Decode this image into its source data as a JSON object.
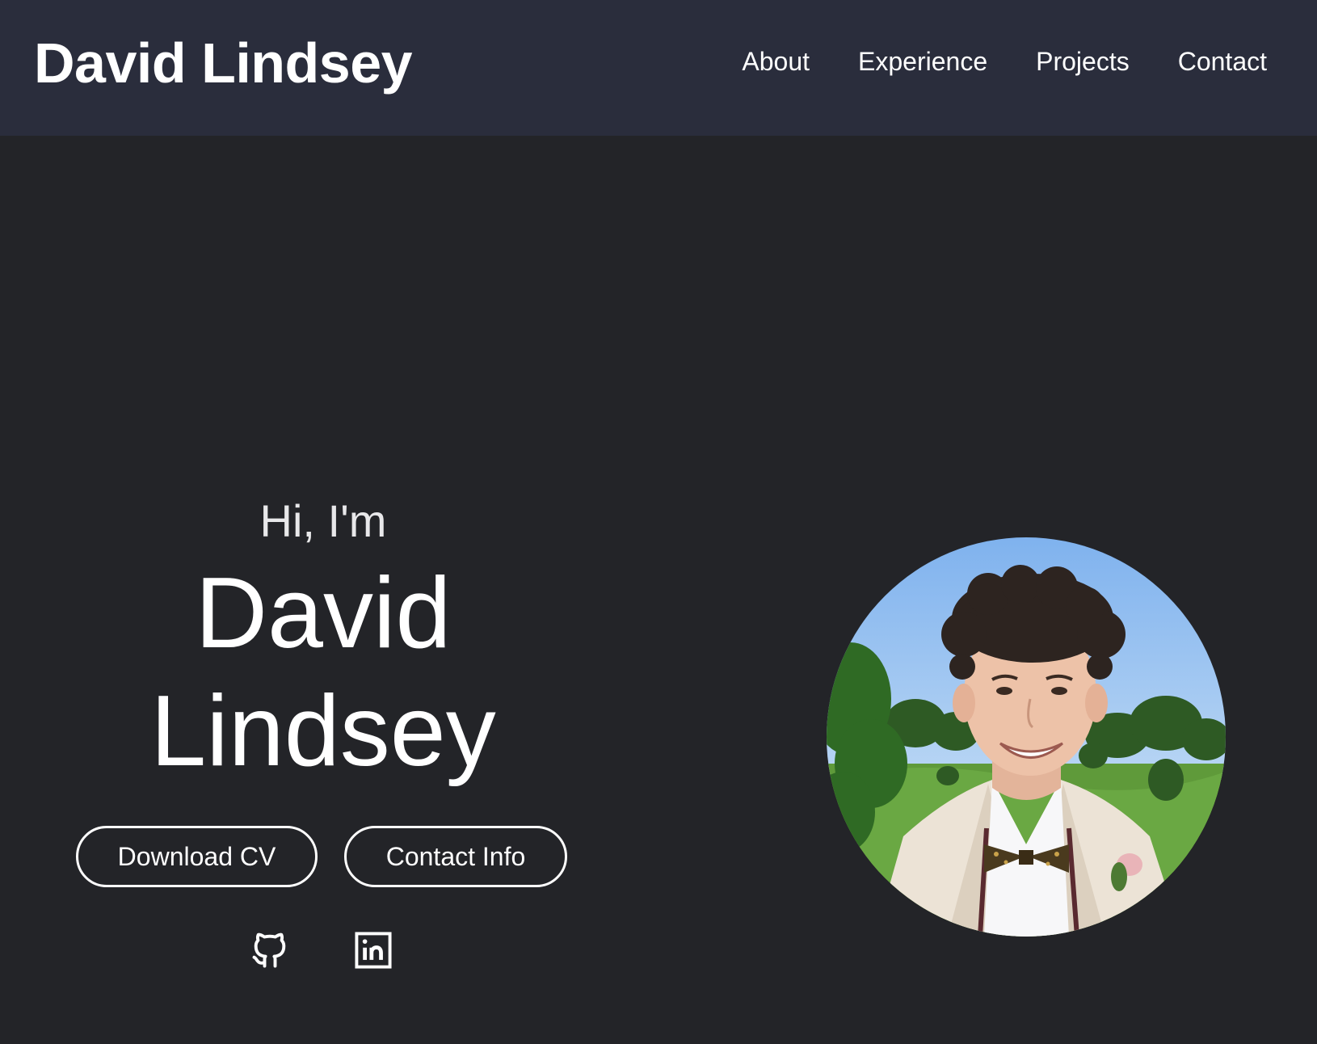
{
  "nav": {
    "logo": "David Lindsey",
    "links": [
      "About",
      "Experience",
      "Projects",
      "Contact"
    ]
  },
  "hero": {
    "greeting": "Hi, I'm",
    "name_line1": "David",
    "name_line2": "Lindsey",
    "buttons": {
      "download_cv": "Download CV",
      "contact_info": "Contact Info"
    },
    "social_icons": [
      "github-icon",
      "linkedin-icon"
    ]
  },
  "colors": {
    "navbar_bg": "#2a2d3c",
    "page_bg": "#232428",
    "text": "#ffffff"
  }
}
